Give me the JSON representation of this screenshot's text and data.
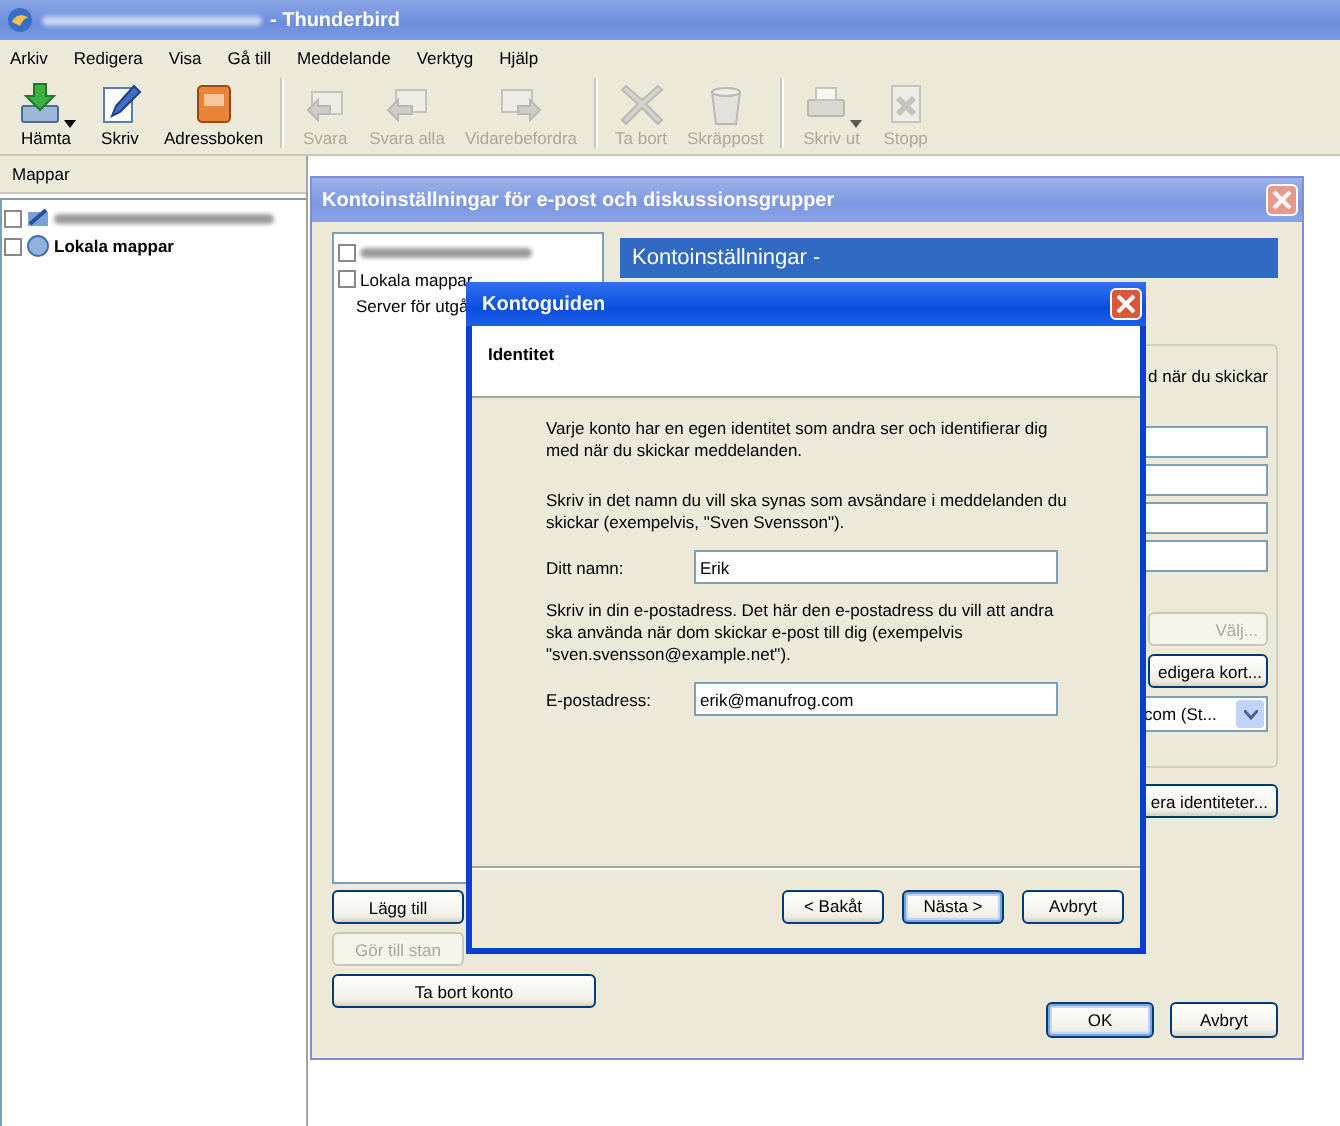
{
  "window": {
    "title": "- Thunderbird"
  },
  "menu": [
    "Arkiv",
    "Redigera",
    "Visa",
    "Gå till",
    "Meddelande",
    "Verktyg",
    "Hjälp"
  ],
  "toolbar": [
    {
      "label": "Hämta",
      "disabled": false,
      "has_menu": true,
      "separator_after": false
    },
    {
      "label": "Skriv",
      "disabled": false,
      "has_menu": false,
      "separator_after": false
    },
    {
      "label": "Adressboken",
      "disabled": false,
      "has_menu": false,
      "separator_after": true
    },
    {
      "label": "Svara",
      "disabled": true,
      "has_menu": false,
      "separator_after": false
    },
    {
      "label": "Svara alla",
      "disabled": true,
      "has_menu": false,
      "separator_after": false
    },
    {
      "label": "Vidarebefordra",
      "disabled": true,
      "has_menu": false,
      "separator_after": true
    },
    {
      "label": "Ta bort",
      "disabled": true,
      "has_menu": false,
      "separator_after": false
    },
    {
      "label": "Skräppost",
      "disabled": true,
      "has_menu": false,
      "separator_after": true
    },
    {
      "label": "Skriv ut",
      "disabled": true,
      "has_menu": true,
      "separator_after": false
    },
    {
      "label": "Stopp",
      "disabled": true,
      "has_menu": false,
      "separator_after": false
    }
  ],
  "folder_pane": {
    "header": "Mappar",
    "folders": [
      {
        "kind": "account"
      },
      {
        "kind": "local",
        "label": "Lokala mappar"
      }
    ]
  },
  "account_settings": {
    "title": "Kontoinställningar för e-post och diskussionsgrupper",
    "tree": [
      {
        "kind": "account"
      },
      {
        "kind": "local",
        "label": "Lokala mappar"
      },
      {
        "kind": "server",
        "label": "Server för utgå"
      }
    ],
    "account_buttons": [
      {
        "label": "Lägg till",
        "disabled": false
      },
      {
        "label": "Gör till stan",
        "disabled": true
      },
      {
        "label": "Ta bort konto",
        "disabled": false
      }
    ],
    "header": "Kontoinställningar -",
    "identity_text": "d när du skickar",
    "choose_button": {
      "label": "Välj...",
      "disabled": true
    },
    "edit_card_button": {
      "label": "edigera kort...",
      "disabled": false
    },
    "signature_dropdown": {
      "value": "com (St..."
    },
    "manage_identities_button": {
      "label": "era identiteter...",
      "disabled": false
    },
    "buttons": [
      {
        "label": "OK",
        "default": true
      },
      {
        "label": "Avbryt",
        "default": false
      }
    ]
  },
  "wizard": {
    "title": "Kontoguiden",
    "page_title": "Identitet",
    "intro": "Varje konto har en egen identitet som andra ser och identifierar dig med när du skickar meddelanden.",
    "name_help": "Skriv in det namn du vill ska synas som avsändare i meddelanden du skickar (exempelvis, \"Sven Svensson\").",
    "name_field": {
      "label": "Ditt namn:",
      "value": "Erik"
    },
    "email_help": "Skriv in din e-postadress. Det här den e-postadress du vill att andra ska använda när dom skickar e-post till dig (exempelvis \"sven.svensson@example.net\").",
    "email_field": {
      "label": "E-postadress:",
      "value": "erik@manufrog.com"
    },
    "buttons": [
      {
        "label": "< Bakåt",
        "default": false
      },
      {
        "label": "Nästa >",
        "default": true
      },
      {
        "label": "Avbryt",
        "default": false
      }
    ]
  }
}
